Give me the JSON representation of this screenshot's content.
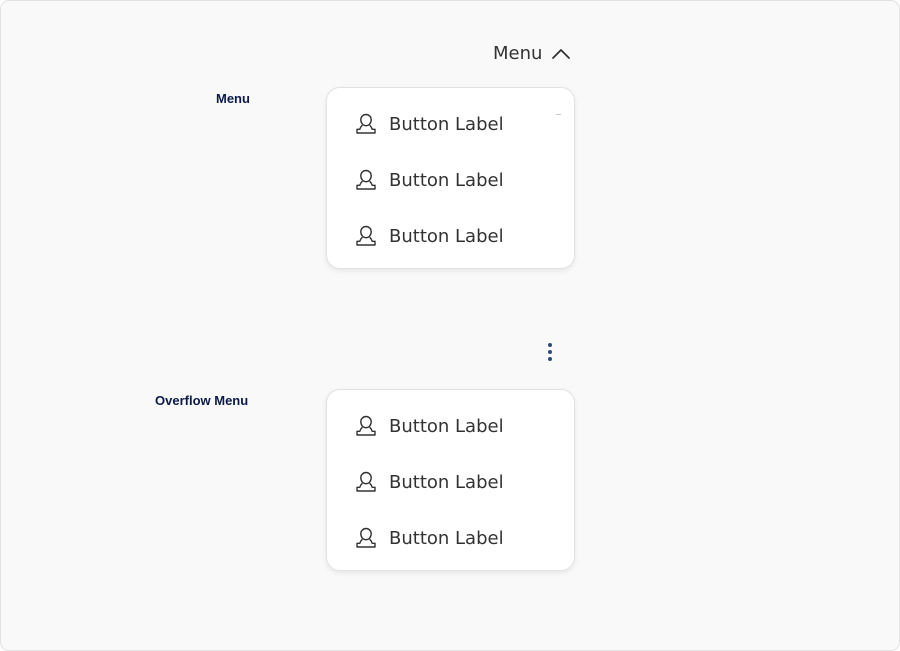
{
  "sections": {
    "menu_label": "Menu",
    "overflow_label": "Overflow Menu"
  },
  "menu": {
    "trigger_label": "Menu",
    "trigger_icon": "chevron-up-icon",
    "items": [
      {
        "label": "Button Label",
        "icon": "user-icon"
      },
      {
        "label": "Button Label",
        "icon": "user-icon"
      },
      {
        "label": "Button Label",
        "icon": "user-icon"
      }
    ]
  },
  "overflow_menu": {
    "trigger_icon": "kebab-icon",
    "trigger_color": "#2e4a7d",
    "items": [
      {
        "label": "Button Label",
        "icon": "user-icon"
      },
      {
        "label": "Button Label",
        "icon": "user-icon"
      },
      {
        "label": "Button Label",
        "icon": "user-icon"
      }
    ]
  }
}
